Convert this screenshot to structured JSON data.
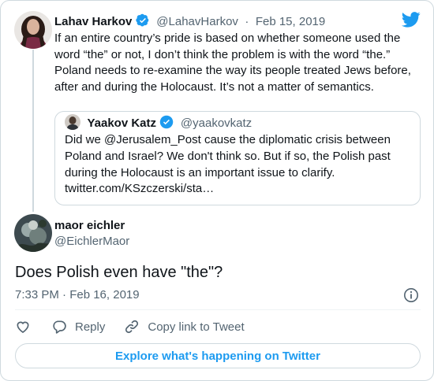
{
  "parent_tweet": {
    "name": "Lahav Harkov",
    "handle": "@LahavHarkov",
    "separator": "·",
    "date": "Feb 15, 2019",
    "text": "If an entire country’s pride is based on whether someone used the word “the” or not, I don’t think the problem is with the word “the.” Poland needs to re-examine the way its people treated Jews before, after and during the Holocaust. It’s not a matter of semantics."
  },
  "quoted_tweet": {
    "name": "Yaakov Katz",
    "handle": "@yaakovkatz",
    "text": "Did we @Jerusalem_Post cause the diplomatic crisis between Poland and Israel? We don't think so. But if so, the Polish past during the Holocaust is an important issue to clarify. twitter.com/KSzczerski/sta…"
  },
  "main_tweet": {
    "name": "maor eichler",
    "handle": "@EichlerMaor",
    "text": "Does Polish even have \"the\"?",
    "timestamp": "7:33 PM · Feb 16, 2019"
  },
  "actions": {
    "like_icon": "heart-icon",
    "reply_label": "Reply",
    "copy_link_label": "Copy link to Tweet"
  },
  "explore_label": "Explore what's happening on Twitter",
  "colors": {
    "accent": "#1d9bf0",
    "text": "#0f1419",
    "muted": "#536471",
    "border": "#cfd9de"
  }
}
